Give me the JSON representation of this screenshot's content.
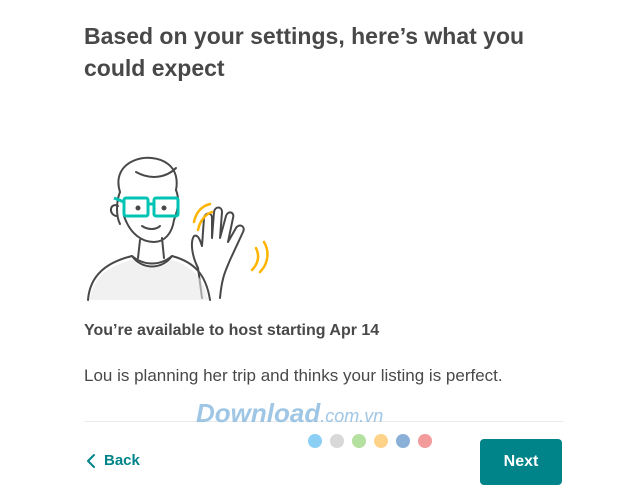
{
  "heading": "Based on your settings, here’s what you could expect",
  "subtitle": "You’re available to host starting Apr 14",
  "body": "Lou is planning her trip and thinks your listing is perfect.",
  "illustration": {
    "icon": "waving-host-illustration",
    "colors": {
      "line": "#484848",
      "glasses": "#00c4b3",
      "accent": "#ffb400"
    }
  },
  "watermark": {
    "main": "Download",
    "suffix": ".com.vn"
  },
  "progress_dots": {
    "colors": [
      "#8ccff5",
      "#d8d8d8",
      "#b4e0a0",
      "#ffd28a",
      "#8ab0d8",
      "#f39a9a"
    ]
  },
  "footer": {
    "back_label": "Back",
    "back_icon": "chevron-left-icon",
    "next_label": "Next"
  },
  "theme": {
    "accent": "#008489",
    "text": "#484848"
  }
}
